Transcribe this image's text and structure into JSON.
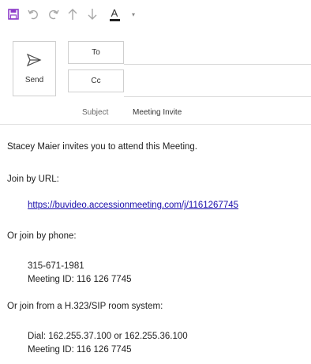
{
  "toolbar": {
    "icons": [
      "save-icon",
      "undo-icon",
      "redo-icon",
      "up-arrow-icon",
      "down-arrow-icon",
      "font-color-icon",
      "customize-dropdown-icon"
    ],
    "font_color_letter": "A",
    "dropdown_glyph": "▾",
    "colors": {
      "save": "#8e3cc9",
      "icons": "#a8a8a8",
      "font_underline": "#222222"
    }
  },
  "compose": {
    "send_label": "Send",
    "to_label": "To",
    "cc_label": "Cc",
    "subject_label": "Subject",
    "subject_value": "Meeting Invite"
  },
  "body": {
    "intro": "Stacey Maier invites you to attend this Meeting.",
    "join_url_heading": "Join by URL:",
    "join_url": "https://buvideo.accessionmeeting.com/j/1161267745",
    "phone_heading": "Or join by phone:",
    "phone_number": "315-671-1981",
    "phone_meeting_id": "Meeting ID: 116 126 7745",
    "room_heading": "Or join from a H.323/SIP room system:",
    "room_dial": "Dial: 162.255.37.100 or 162.255.36.100",
    "room_meeting_id": "Meeting ID: 116 126 7745"
  },
  "colors": {
    "frame_background": "#2e6db4",
    "link": "#1a0dab"
  }
}
